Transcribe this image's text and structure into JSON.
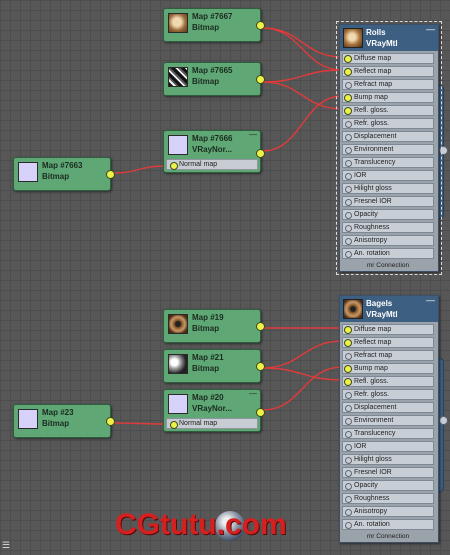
{
  "map_nodes": [
    {
      "id": "n7667",
      "title": "Map #7667",
      "subtitle": "Bitmap",
      "thumb": "t1"
    },
    {
      "id": "n7665",
      "title": "Map #7665",
      "subtitle": "Bitmap",
      "thumb": "t2"
    },
    {
      "id": "n7666",
      "title": "Map #7666",
      "subtitle": "VRayNor...",
      "thumb": "lav",
      "slot": "Normal map",
      "mini": "—"
    },
    {
      "id": "n7663",
      "title": "Map #7663",
      "subtitle": "Bitmap",
      "thumb": "lav"
    },
    {
      "id": "n19",
      "title": "Map #19",
      "subtitle": "Bitmap",
      "thumb": "t3"
    },
    {
      "id": "n21",
      "title": "Map #21",
      "subtitle": "Bitmap",
      "thumb": "t4"
    },
    {
      "id": "n20",
      "title": "Map #20",
      "subtitle": "VRayNor...",
      "thumb": "lav",
      "slot": "Normal map",
      "mini": "—"
    },
    {
      "id": "n23",
      "title": "Map #23",
      "subtitle": "Bitmap",
      "thumb": "lav"
    }
  ],
  "materials": [
    {
      "id": "m1",
      "title": "Rolls",
      "subtitle": "VRayMtl",
      "mini": "—",
      "slots": [
        "Diffuse map",
        "Reflect map",
        "Refract map",
        "Bump map",
        "Refl. gloss.",
        "Refr. gloss.",
        "Displacement",
        "Environment",
        "Translucency",
        "IOR",
        "Hilight gloss",
        "Fresnel IOR",
        "Opacity",
        "Roughness",
        "Anisotropy",
        "An. rotation"
      ],
      "connected": [
        0,
        1,
        3,
        4
      ],
      "footer": "mr Connection"
    },
    {
      "id": "m2",
      "title": "Bagels",
      "subtitle": "VRayMtl",
      "mini": "—",
      "slots": [
        "Diffuse map",
        "Reflect map",
        "Refract map",
        "Bump map",
        "Refl. gloss.",
        "Refr. gloss.",
        "Displacement",
        "Environment",
        "Translucency",
        "IOR",
        "Hilight gloss",
        "Fresnel IOR",
        "Opacity",
        "Roughness",
        "Anisotropy",
        "An. rotation"
      ],
      "connected": [
        0,
        1,
        3,
        4
      ],
      "footer": "mr Connection"
    }
  ],
  "watermark": "CGtutu.com",
  "colors": {
    "wire": "#e03a3a",
    "node": "#5fa876",
    "material_header": "#3d5f82",
    "socket_active": "#ecf24a"
  }
}
